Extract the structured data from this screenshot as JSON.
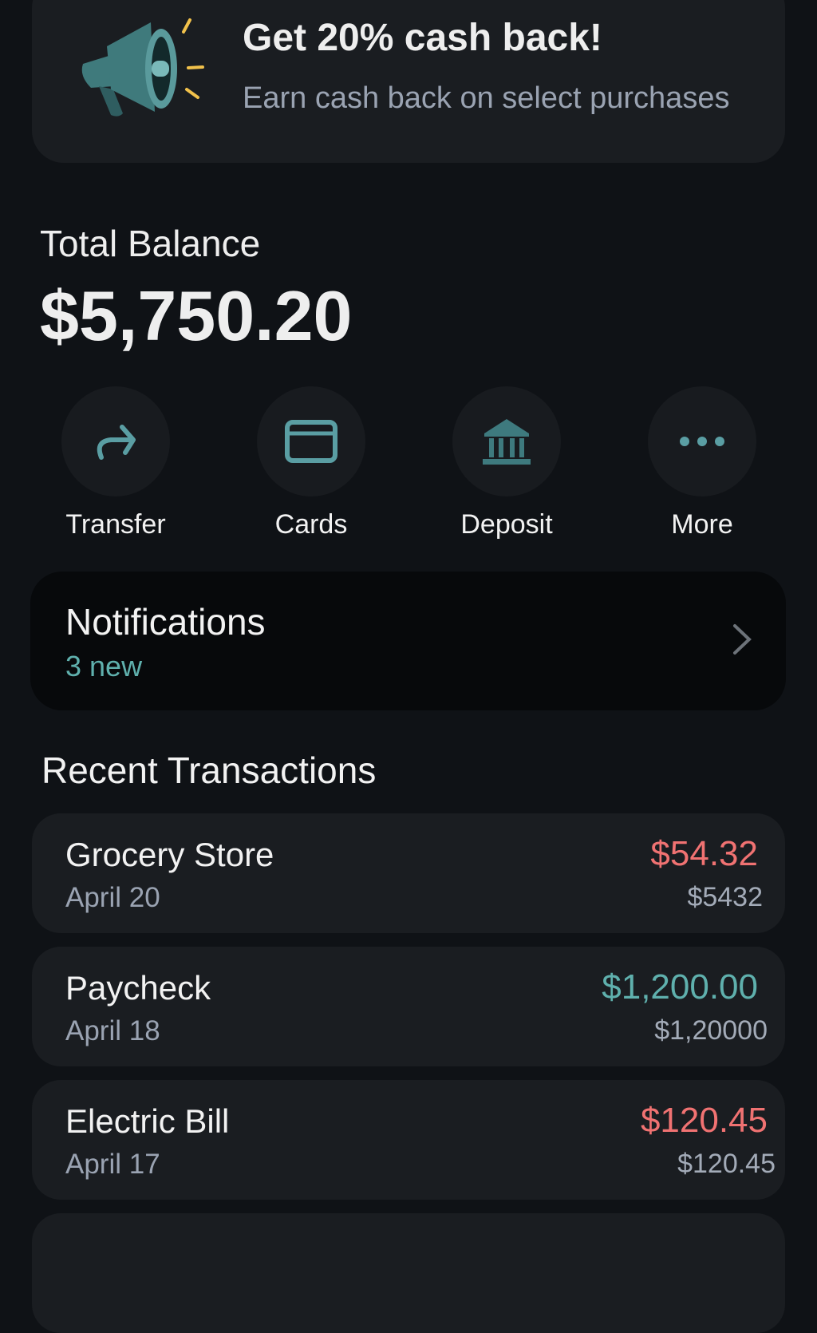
{
  "promo": {
    "title": "Get 20% cash back!",
    "subtitle": "Earn cash back on select purchases",
    "icon": "megaphone-icon"
  },
  "balance": {
    "label": "Total Balance",
    "value": "$5,750.20"
  },
  "actions": [
    {
      "label": "Transfer",
      "icon": "share-arrow-icon"
    },
    {
      "label": "Cards",
      "icon": "card-icon"
    },
    {
      "label": "Deposit",
      "icon": "bank-icon"
    },
    {
      "label": "More",
      "icon": "more-dots-icon"
    }
  ],
  "notifications": {
    "title": "Notifications",
    "count": "3 new"
  },
  "transactions_title": "Recent Transactions",
  "transactions": [
    {
      "name": "Grocery Store",
      "date": "April 20",
      "amount": "$54.32",
      "sub": "$5432",
      "type": "debit"
    },
    {
      "name": "Paycheck",
      "date": "April 18",
      "amount": "$1,200.00",
      "sub": "$1,20000",
      "type": "credit"
    },
    {
      "name": "Electric Bill",
      "date": "April 17",
      "amount": "$120.45",
      "sub": "$120.45",
      "type": "debit"
    }
  ],
  "colors": {
    "accent": "#5fb0ad",
    "debit": "#f07272",
    "credit": "#5fb0ad",
    "background": "#0f1216",
    "card": "#1a1d21"
  }
}
